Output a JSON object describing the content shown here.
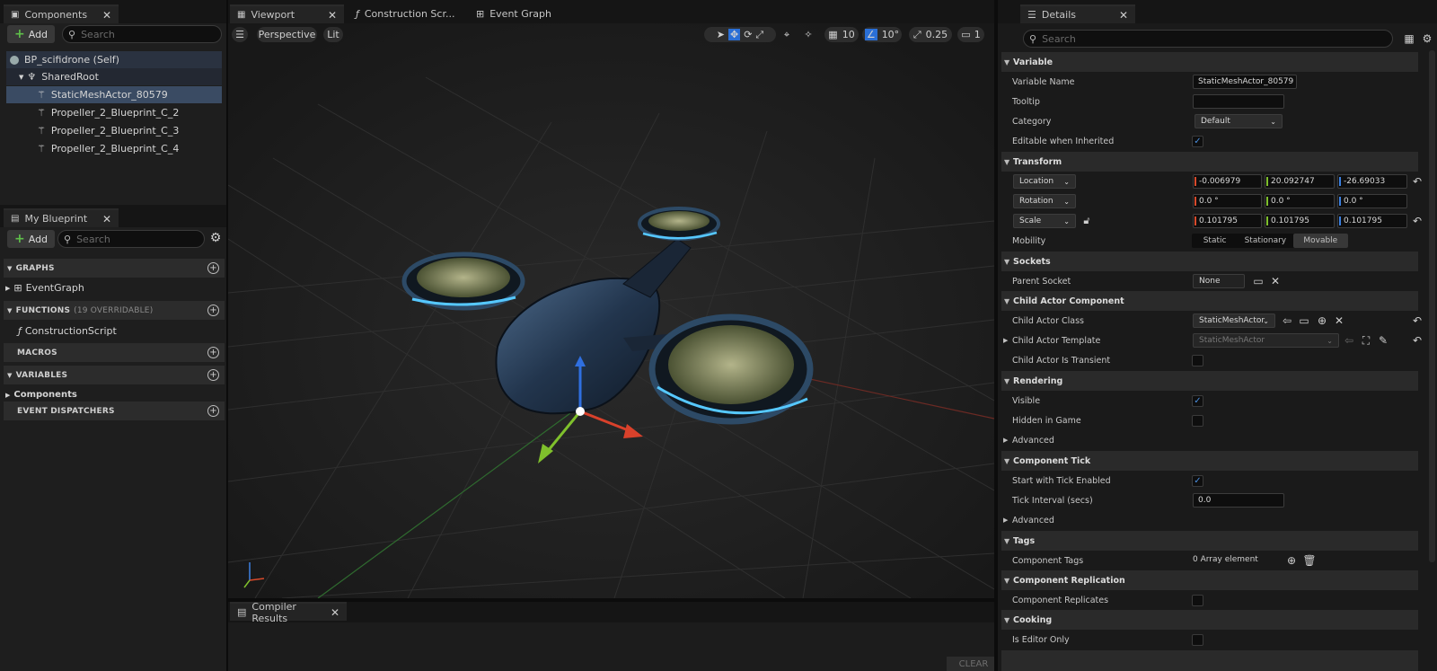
{
  "components_panel": {
    "tab_label": "Components",
    "add_label": "Add",
    "search_placeholder": "Search",
    "tree": [
      {
        "label": "BP_scifidrone (Self)"
      },
      {
        "label": "SharedRoot"
      },
      {
        "label": "StaticMeshActor_80579"
      },
      {
        "label": "Propeller_2_Blueprint_C_2"
      },
      {
        "label": "Propeller_2_Blueprint_C_3"
      },
      {
        "label": "Propeller_2_Blueprint_C_4"
      }
    ]
  },
  "my_blueprint": {
    "tab_label": "My Blueprint",
    "add_label": "Add",
    "search_placeholder": "Search",
    "graphs_label": "GRAPHS",
    "event_graph_label": "EventGraph",
    "functions_label": "FUNCTIONS",
    "functions_note": "(19 OVERRIDABLE)",
    "construction_script_label": "ConstructionScript",
    "macros_label": "MACROS",
    "variables_label": "VARIABLES",
    "components_label": "Components",
    "event_dispatchers_label": "EVENT DISPATCHERS"
  },
  "editor_tabs": {
    "viewport": "Viewport",
    "construction_script": "Construction Scr...",
    "event_graph": "Event Graph"
  },
  "viewport_toolbar": {
    "perspective": "Perspective",
    "lit": "Lit",
    "grid_snap": "10",
    "rotation_snap": "10°",
    "scale_snap": "0.25",
    "camera_speed": "1"
  },
  "compiler": {
    "tab_label": "Compiler Results",
    "clear_label": "CLEAR"
  },
  "details": {
    "tab_label": "Details",
    "search_placeholder": "Search",
    "sections": {
      "variable": "Variable",
      "transform": "Transform",
      "sockets": "Sockets",
      "child_actor_component": "Child Actor Component",
      "rendering": "Rendering",
      "component_tick": "Component Tick",
      "tags": "Tags",
      "component_replication": "Component Replication",
      "cooking": "Cooking"
    },
    "labels": {
      "variable_name": "Variable Name",
      "tooltip": "Tooltip",
      "category": "Category",
      "editable_when_inherited": "Editable when Inherited",
      "mobility": "Mobility",
      "parent_socket": "Parent Socket",
      "child_actor_class": "Child Actor Class",
      "child_actor_template": "Child Actor Template",
      "child_actor_is_transient": "Child Actor Is Transient",
      "visible": "Visible",
      "hidden_in_game": "Hidden in Game",
      "advanced": "Advanced",
      "start_with_tick_enabled": "Start with Tick Enabled",
      "tick_interval": "Tick Interval (secs)",
      "component_tags": "Component Tags",
      "component_replicates": "Component Replicates",
      "is_editor_only": "Is Editor Only"
    },
    "values": {
      "variable_name": "StaticMeshActor_80579",
      "tooltip": "",
      "category": "Default",
      "location_label": "Location",
      "location": [
        "-0.006979",
        "20.092747",
        "-26.69033"
      ],
      "rotation_label": "Rotation",
      "rotation": [
        "0.0 °",
        "0.0 °",
        "0.0 °"
      ],
      "scale_label": "Scale",
      "scale": [
        "0.101795",
        "0.101795",
        "0.101795"
      ],
      "mobility_options": [
        "Static",
        "Stationary",
        "Movable"
      ],
      "mobility_selected": "Movable",
      "parent_socket": "None",
      "child_actor_class": "StaticMeshActor",
      "child_actor_template": "StaticMeshActor",
      "tick_interval": "0.0",
      "component_tags": "0 Array element"
    },
    "checks": {
      "editable_when_inherited": true,
      "child_actor_is_transient": false,
      "visible": true,
      "hidden_in_game": false,
      "start_with_tick_enabled": true,
      "component_replicates": false,
      "is_editor_only": false
    }
  },
  "colors": {
    "selected_row": "#3a4b63",
    "accent_blue": "#2a6fd6",
    "axis_x": "#d94a2b",
    "axis_y": "#7fc02c",
    "axis_z": "#3c80e0"
  }
}
